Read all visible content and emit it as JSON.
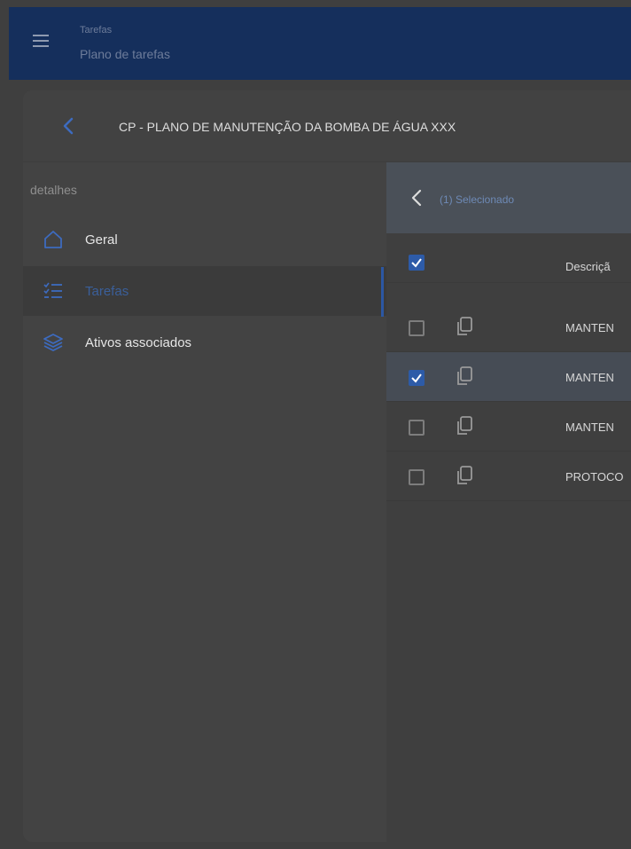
{
  "header": {
    "section": "Tarefas",
    "subtitle": "Plano de tarefas"
  },
  "page": {
    "title": "CP - PLANO DE MANUTENÇÃO DA BOMBA DE ÁGUA XXX"
  },
  "sidebar": {
    "section_label": "detalhes",
    "items": [
      {
        "label": "Geral",
        "icon": "home-icon",
        "active": false
      },
      {
        "label": "Tarefas",
        "icon": "checklist-icon",
        "active": true
      },
      {
        "label": "Ativos associados",
        "icon": "layers-icon",
        "active": false
      }
    ]
  },
  "table": {
    "selection_label": "(1) Selecionado",
    "column_header": "Descriçã",
    "rows": [
      {
        "text": "MANTEN",
        "checked": false
      },
      {
        "text": "MANTEN",
        "checked": true
      },
      {
        "text": "MANTEN",
        "checked": false
      },
      {
        "text": "PROTOCO",
        "checked": false
      }
    ]
  },
  "colors": {
    "header_bg": "#152f5c",
    "accent": "#2d5ba8",
    "overlay_bg": "#3f3f3f"
  }
}
